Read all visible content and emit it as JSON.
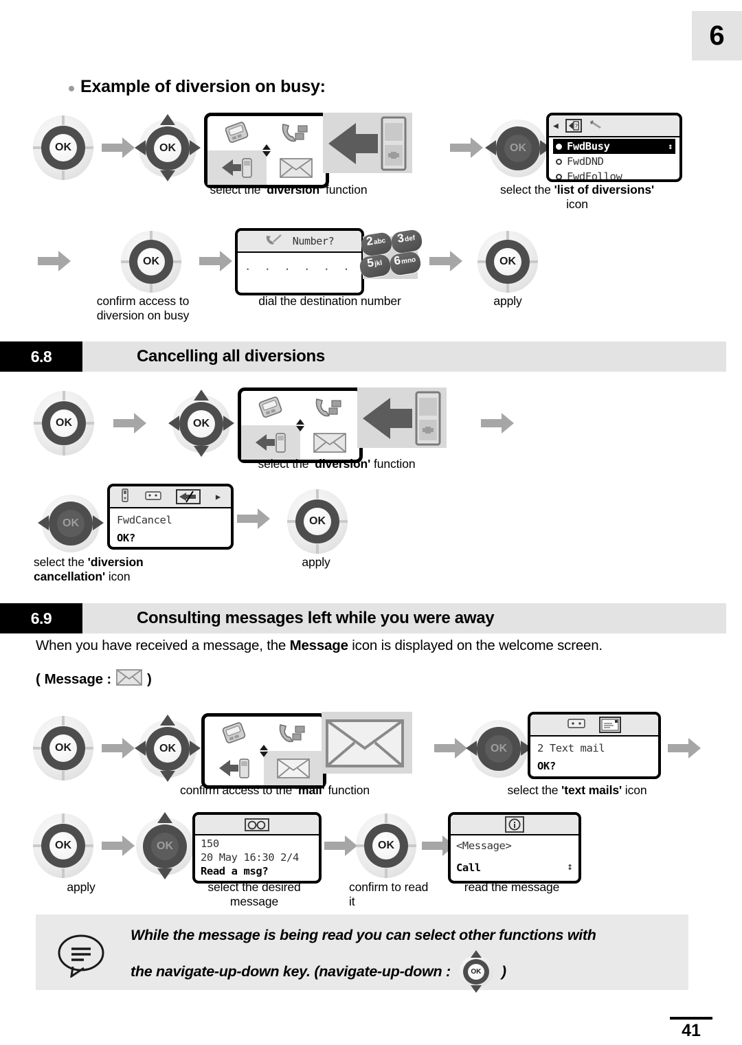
{
  "page": {
    "chapter_tab": "6",
    "page_number": "41"
  },
  "heading": {
    "bullet_heading": "Example of diversion on busy:"
  },
  "sections": [
    {
      "number": "6.8",
      "title": "Cancelling all diversions"
    },
    {
      "number": "6.9",
      "title": "Consulting messages left while you were away"
    }
  ],
  "intro": {
    "line_before": "When you have received a message, the ",
    "line_bold": "Message",
    "line_after": " icon is displayed on the welcome screen.",
    "message_prefix": "(",
    "message_label": "Message :",
    "message_suffix": ")"
  },
  "flow_busy": {
    "captions": {
      "select_diversion": {
        "pre": "select the ",
        "bold": "'diversion'",
        "post": " function"
      },
      "select_list": {
        "pre": "select the ",
        "bold": "'list of diversions'",
        "post": "",
        "second_line": "icon"
      },
      "confirm_access": "confirm access to\ndiversion on busy",
      "confirm_access_l1": "confirm access to",
      "confirm_access_l2": "diversion on busy",
      "dial_number": "dial the destination number",
      "apply": "apply"
    },
    "lcd_list": {
      "title_icons": [
        "diversion-help-icon",
        "wrench-icon"
      ],
      "items": [
        {
          "label": "FwdBusy",
          "selected": true
        },
        {
          "label": "FwdDND",
          "selected": false
        },
        {
          "label": "FwdFollow",
          "selected": false
        }
      ]
    },
    "lcd_number": {
      "icon": "handset-pencil-icon",
      "prompt": "Number?",
      "entry": ". . . . . . ."
    },
    "keypad": [
      {
        "digit": "2",
        "letters": "abc"
      },
      {
        "digit": "3",
        "letters": "def"
      },
      {
        "digit": "5",
        "letters": "jkl"
      },
      {
        "digit": "6",
        "letters": "mno"
      }
    ]
  },
  "flow_cancel": {
    "captions": {
      "select_diversion": {
        "pre": "select the ",
        "bold": "'diversion'",
        "post": " function"
      },
      "select_cancel_l1_pre": "select the ",
      "select_cancel_l1_bold": "'diversion",
      "select_cancel_l2_bold": "cancellation'",
      "select_cancel_l2_post": " icon",
      "apply": "apply"
    },
    "lcd_cancel": {
      "title_icons": [
        "phone-icon",
        "answering-machine-icon",
        "diversion-cancel-icon"
      ],
      "line1": "FwdCancel",
      "line2": "OK?"
    }
  },
  "flow_messages": {
    "captions": {
      "confirm_mail": {
        "pre": "confirm access to the ",
        "bold": "'mail'",
        "post": " function"
      },
      "select_text_mails": {
        "pre": "select the ",
        "bold": "'text mails'",
        "post": " icon"
      },
      "apply": "apply",
      "select_desired_l1": "select the desired",
      "select_desired_l2": "message",
      "confirm_read_l1": "confirm to read",
      "confirm_read_l2": "it",
      "read_message": "read the message"
    },
    "lcd_textmail": {
      "title_icons": [
        "answering-machine-icon",
        "text-mail-icon"
      ],
      "line1": "2 Text mail",
      "line2": "OK?"
    },
    "lcd_msglist": {
      "title_icons": [
        "glasses-icon"
      ],
      "line1": "150",
      "line2": "20 May 16:30 2/4",
      "line3": "Read a msg?"
    },
    "lcd_read": {
      "title_icons": [
        "info-icon"
      ],
      "line1": "<Message>",
      "line2": "Call"
    }
  },
  "note": {
    "line1": "While the message is being read you can select other functions with",
    "line2_a": "the navigate-up-down key.  (navigate-up-down :",
    "line2_b": ")",
    "icon": "note-speech-bubble-icon"
  },
  "keys": {
    "ok_label": "OK"
  },
  "colors": {
    "bar_grey": "#e3e3e3",
    "bar_black": "#000000",
    "arrow_grey": "#a6a6a6",
    "key_ring": "#4d4d4d"
  }
}
